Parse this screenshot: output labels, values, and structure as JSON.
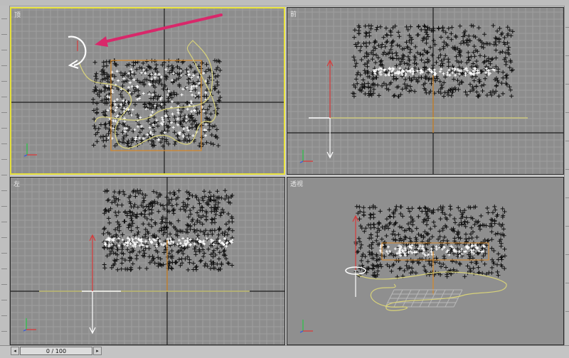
{
  "viewports": {
    "top": {
      "label": "顶"
    },
    "front": {
      "label": "前"
    },
    "left": {
      "label": "左"
    },
    "perspective": {
      "label": "透视"
    }
  },
  "time_slider": {
    "text": "0 / 100",
    "frame": 0,
    "total": 100
  },
  "colors": {
    "viewport_bg": "#8d8d8d",
    "grid_line": "#9e9e9e",
    "axis_line": "#1e1e1e",
    "active_border": "#e8e23c",
    "particles_dark": "#111111",
    "particles_light": "#ffffff",
    "emitter_orange": "#d88a2a",
    "spline_yellow": "#d8d27a",
    "arrow_annotation": "#d8286a"
  },
  "icons": [
    "rotate-gizmo-icon",
    "axis-tripod-icon",
    "timeline-prev-icon",
    "timeline-next-icon"
  ]
}
